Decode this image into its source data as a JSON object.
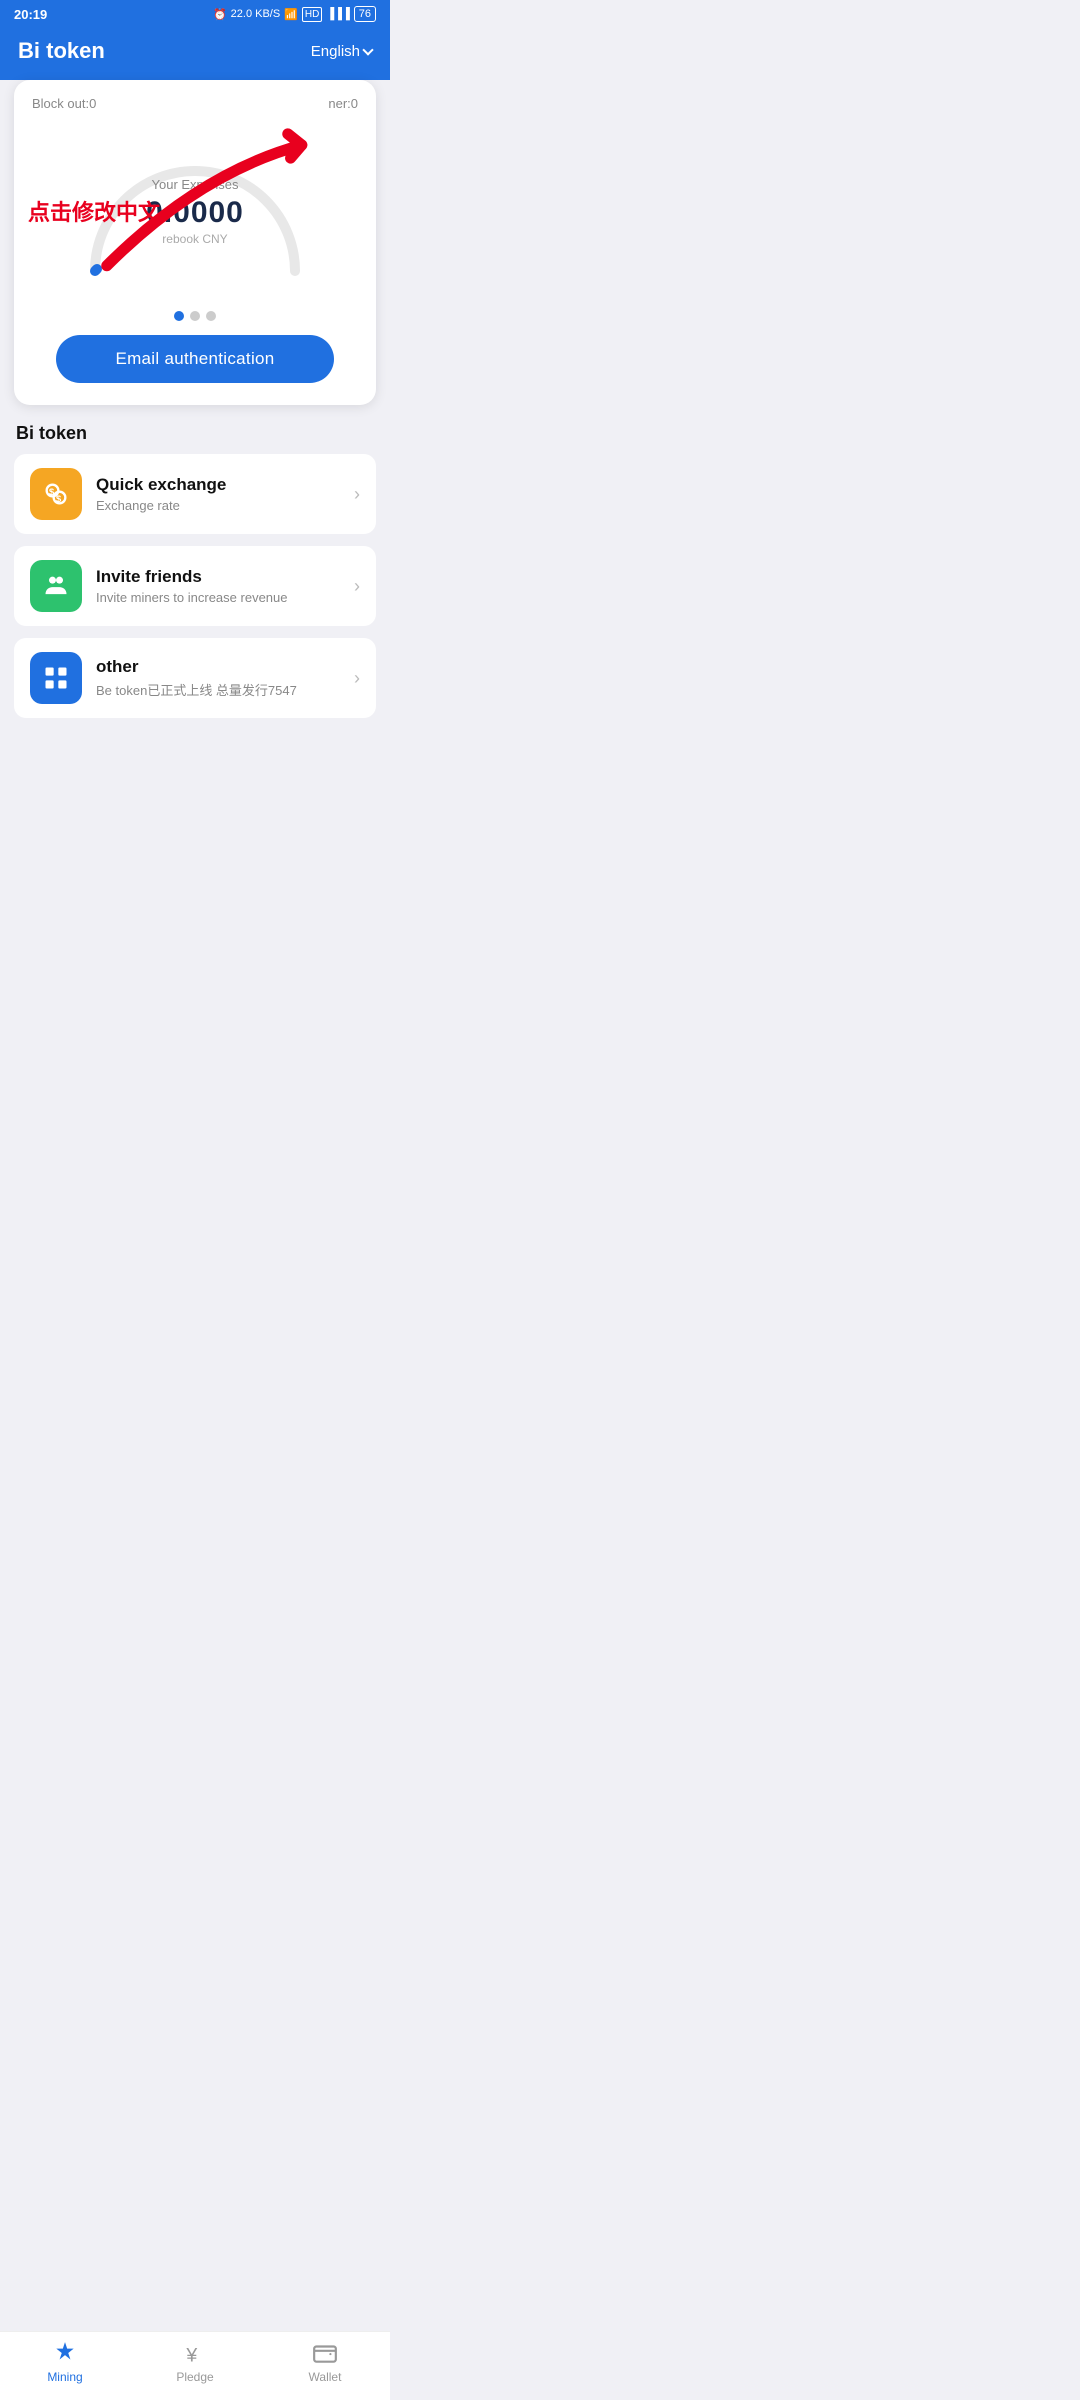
{
  "app": {
    "title": "Bi token",
    "language": "English"
  },
  "statusBar": {
    "time": "20:19",
    "network": "22.0 KB/S"
  },
  "card": {
    "blockOut": "Block out:0",
    "minerLabel": "ner:0",
    "expensesLabel": "Your Expenses",
    "expensesValue": "0.0000",
    "expensesUnit": "rebook CNY",
    "annotation": "点击修改中文"
  },
  "emailButton": {
    "label": "Email authentication"
  },
  "biTokenSection": {
    "title": "Bi token"
  },
  "menuItems": [
    {
      "id": "quick-exchange",
      "title": "Quick exchange",
      "subtitle": "Exchange rate",
      "iconType": "orange"
    },
    {
      "id": "invite-friends",
      "title": "Invite friends",
      "subtitle": "Invite miners to increase revenue",
      "iconType": "green"
    },
    {
      "id": "other",
      "title": "other",
      "subtitle": "Be token已正式上线 总量发行7547",
      "iconType": "blue"
    }
  ],
  "bottomNav": {
    "items": [
      {
        "id": "mining",
        "label": "Mining",
        "active": true
      },
      {
        "id": "pledge",
        "label": "Pledge",
        "active": false
      },
      {
        "id": "wallet",
        "label": "Wallet",
        "active": false
      }
    ]
  }
}
